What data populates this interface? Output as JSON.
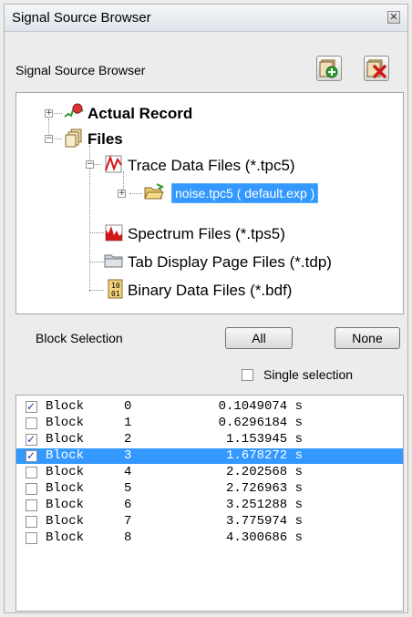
{
  "window": {
    "title": "Signal Source Browser"
  },
  "header": {
    "label": "Signal Source Browser"
  },
  "tree": {
    "actual_record": "Actual Record",
    "files": "Files",
    "trace_files": "Trace Data Files (*.tpc5)",
    "noise_file": "noise.tpc5  ( default.exp )",
    "spectrum_files": "Spectrum Files (*.tps5)",
    "tab_files": "Tab Display Page Files (*.tdp)",
    "binary_files": "Binary Data Files (*.bdf)"
  },
  "block_selection": {
    "label": "Block Selection",
    "all_label": "All",
    "none_label": "None",
    "single_label": "Single selection",
    "single_checked": false
  },
  "blocks": [
    {
      "name": "Block",
      "index": "0",
      "time": "0.1049074 s",
      "checked": true,
      "selected": false
    },
    {
      "name": "Block",
      "index": "1",
      "time": "0.6296184 s",
      "checked": false,
      "selected": false
    },
    {
      "name": "Block",
      "index": "2",
      "time": "1.153945 s",
      "checked": true,
      "selected": false
    },
    {
      "name": "Block",
      "index": "3",
      "time": "1.678272 s",
      "checked": true,
      "selected": true
    },
    {
      "name": "Block",
      "index": "4",
      "time": "2.202568 s",
      "checked": false,
      "selected": false
    },
    {
      "name": "Block",
      "index": "5",
      "time": "2.726963 s",
      "checked": false,
      "selected": false
    },
    {
      "name": "Block",
      "index": "6",
      "time": "3.251288 s",
      "checked": false,
      "selected": false
    },
    {
      "name": "Block",
      "index": "7",
      "time": "3.775974 s",
      "checked": false,
      "selected": false
    },
    {
      "name": "Block",
      "index": "8",
      "time": "4.300686 s",
      "checked": false,
      "selected": false
    }
  ],
  "colors": {
    "selection": "#3399ff"
  }
}
